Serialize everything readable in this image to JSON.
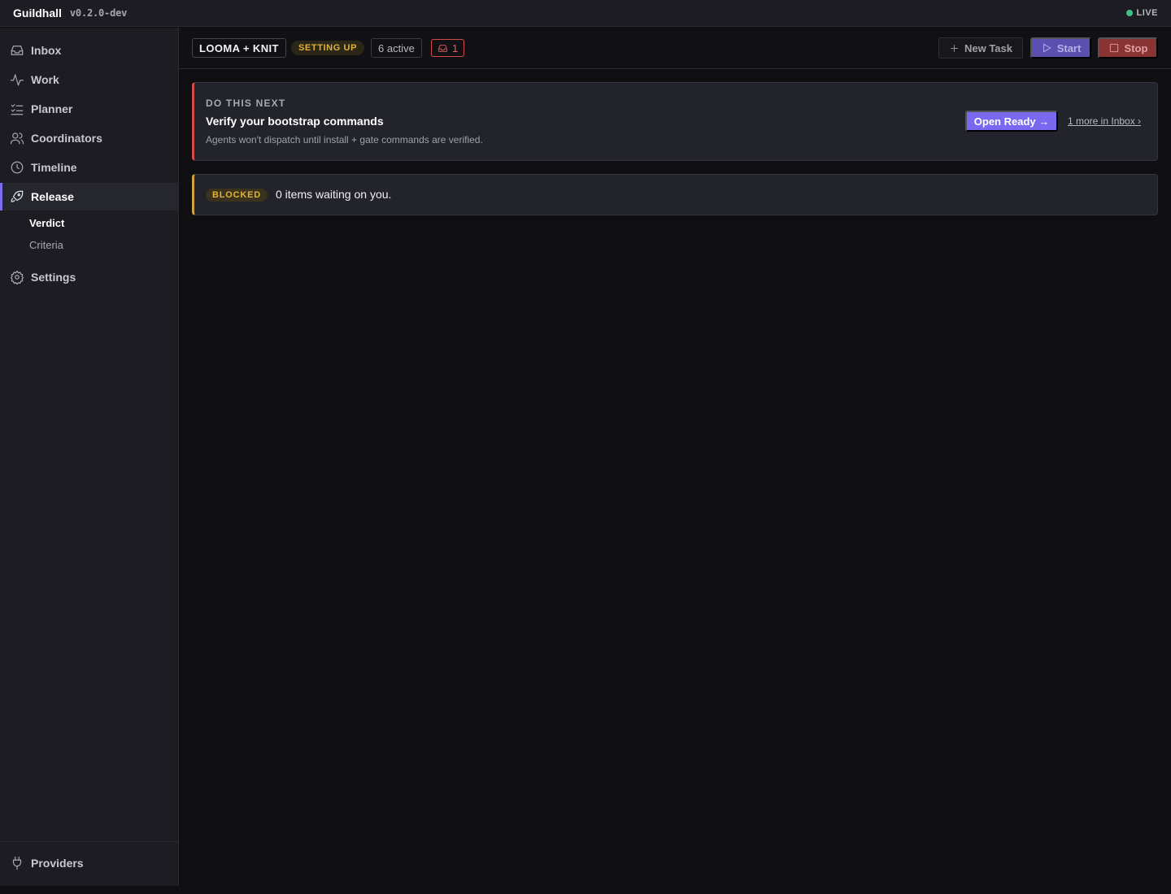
{
  "app": {
    "name": "Guildhall",
    "version": "v0.2.0-dev",
    "status": "LIVE"
  },
  "sidebar": {
    "items": [
      {
        "label": "Inbox",
        "icon": "inbox-icon"
      },
      {
        "label": "Work",
        "icon": "activity-icon"
      },
      {
        "label": "Planner",
        "icon": "list-checks-icon"
      },
      {
        "label": "Coordinators",
        "icon": "users-icon"
      },
      {
        "label": "Timeline",
        "icon": "clock-icon"
      },
      {
        "label": "Release",
        "icon": "rocket-icon",
        "active": true
      },
      {
        "label": "Settings",
        "icon": "gear-icon"
      }
    ],
    "release_sub": [
      {
        "label": "Verdict",
        "active": true
      },
      {
        "label": "Criteria"
      }
    ],
    "footer": {
      "label": "Providers",
      "icon": "plug-icon"
    }
  },
  "header": {
    "project": "LOOMA + KNIT",
    "status": "SETTING UP",
    "active": "6 active",
    "inbox_count": "1",
    "new_task": "New Task",
    "start": "Start",
    "stop": "Stop"
  },
  "next_card": {
    "label": "DO THIS NEXT",
    "title": "Verify your bootstrap commands",
    "description": "Agents won't dispatch until install + gate commands are verified.",
    "action": "Open Ready →",
    "more": "1 more in Inbox ›"
  },
  "blocked_card": {
    "label": "BLOCKED",
    "text": "0 items waiting on you."
  },
  "colors": {
    "accent": "#7b68f0",
    "danger": "#d24a4a",
    "warning": "#e0b23a",
    "live": "#3fbf8a"
  }
}
